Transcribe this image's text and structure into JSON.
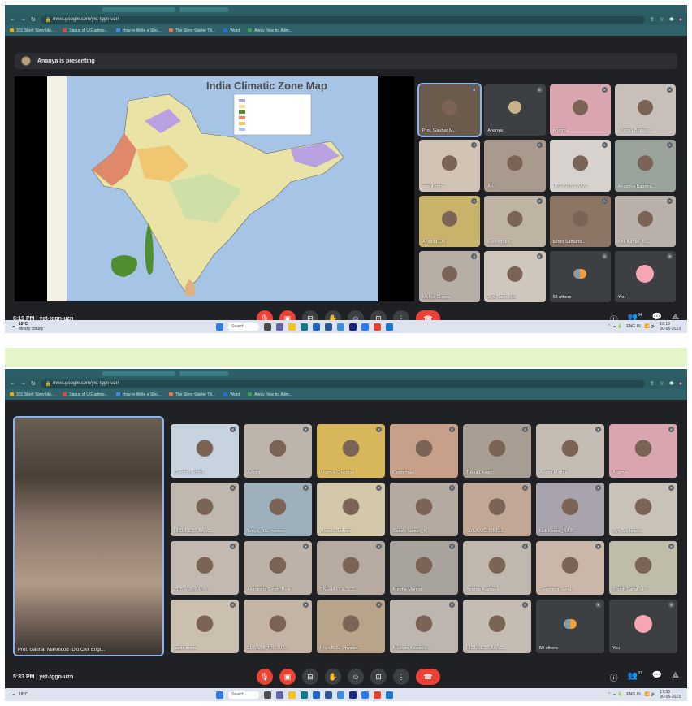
{
  "browser": {
    "url": "meet.google.com/yet-tggn-uzn",
    "bookmarks": [
      "301 Short Story Ide...",
      "Status of UG admis...",
      "How to Write a Sho...",
      "The Story Starter Th...",
      "Word",
      "Apply Now for Adm..."
    ],
    "nav_icons": [
      "back-icon",
      "forward-icon",
      "reload-icon",
      "lock-icon"
    ]
  },
  "screen1": {
    "presenting": "Ananya is presenting",
    "slide_title": "India Climatic Zone Map",
    "time": "6:19 PM",
    "meeting_code": "yet-tggn-uzn",
    "participants": [
      {
        "name": "Prof. Gauhar M...",
        "color": "#6b5b4a",
        "active": true
      },
      {
        "name": "Ananya",
        "color": "#3c4043",
        "avatar": true
      },
      {
        "name": "Ananya",
        "color": "#d9a6b0"
      },
      {
        "name": "Ananya Bajpeyi...",
        "color": "#c7bfb8"
      },
      {
        "name": "aashi tomar",
        "color": "#d1c4b5"
      },
      {
        "name": "Ap...",
        "color": "#a89b8d"
      },
      {
        "name": "HIGHNESS AAN...",
        "color": "#d7d2cd"
      },
      {
        "name": "Anushka Bagena...",
        "color": "#9aa39c"
      },
      {
        "name": "Anshita Ch...",
        "color": "#c9b26a"
      },
      {
        "name": "Kashvinder...",
        "color": "#bfb3a3"
      },
      {
        "name": "tahoo Samanti...",
        "color": "#8d7565"
      },
      {
        "name": "Nidi Kamal_BS...",
        "color": "#b9b1a9"
      },
      {
        "name": "Mehak Gupta",
        "color": "#b7aea5"
      },
      {
        "name": "Jiya Sachdeva",
        "color": "#cfc6bc"
      },
      {
        "name": "68 others",
        "color": "#3c4043",
        "others": true
      },
      {
        "name": "You",
        "color": "#3c4043",
        "you": true
      }
    ]
  },
  "screen2": {
    "featured_name": "Prof. Gauhar Mahmood (Dio Civil Engi...",
    "time": "5:33 PM",
    "meeting_code": "yet-tggn-uzn",
    "participants": [
      {
        "name": "Chesta Bishnoi...",
        "color": "#c8d3e0"
      },
      {
        "name": "Ayushi",
        "color": "#bdb4ab"
      },
      {
        "name": "Ananya Chauhan",
        "color": "#d8b75a"
      },
      {
        "name": "Deepmala",
        "color": "#c8a08a"
      },
      {
        "name": "Tulika Diwan",
        "color": "#a99e93"
      },
      {
        "name": "Ayushi Mathur",
        "color": "#c5bdb3"
      },
      {
        "name": "Ananya",
        "color": "#d9a6b0"
      },
      {
        "name": "HIGHNESS AANC...",
        "color": "#c0b8ae"
      },
      {
        "name": "Tanya_BSc honbo...",
        "color": "#9db0bb"
      },
      {
        "name": "Mridula Rathore",
        "color": "#d2c8a9"
      },
      {
        "name": "Sakshi kumari_h...",
        "color": "#b4aaa0"
      },
      {
        "name": "SHIVANGI SINGH...",
        "color": "#c1a896"
      },
      {
        "name": "Nidi Kamal_BA P...",
        "color": "#a8a3ad"
      },
      {
        "name": "Jiya Sachdeva",
        "color": "#c9c2b9"
      },
      {
        "name": "21/SW06_SANY...",
        "color": "#c3b9b0"
      },
      {
        "name": "Akanksha Singh_Polit...",
        "color": "#bdb2a7"
      },
      {
        "name": "SNEHA POL SCI...",
        "color": "#b7aaa0"
      },
      {
        "name": "Megha Manral",
        "color": "#a9a39e"
      },
      {
        "name": "Aparna Agarwal",
        "color": "#c0b7ae"
      },
      {
        "name": "Swarnima Jayat...",
        "color": "#cab7a9"
      },
      {
        "name": "Shubh Saifal_Ho...",
        "color": "#bfbcaa"
      },
      {
        "name": "aashi tomar",
        "color": "#cbbfb0"
      },
      {
        "name": "21/SW08_PR.../UA...",
        "color": "#c4b4a6"
      },
      {
        "name": "Priya B.Sc Physics...",
        "color": "#b8a48a"
      },
      {
        "name": "Muskan Kawatra...",
        "color": "#bdb6ae"
      },
      {
        "name": "HIGHNESS AANC...",
        "color": "#c5bcb3"
      },
      {
        "name": "59 others",
        "color": "#3c4043",
        "others": true
      },
      {
        "name": "You",
        "color": "#3c4043",
        "you": true
      }
    ]
  },
  "controls": {
    "right_count1": "84",
    "right_count2": "87"
  },
  "taskbar": {
    "weather": "18°C",
    "weather_sub": "Mostly cloudy",
    "search": "Search",
    "lang": "ENG IN",
    "time1": "18:19",
    "date1": "30-05-2023",
    "time2": "17:33",
    "date2": "30-05-2023"
  }
}
